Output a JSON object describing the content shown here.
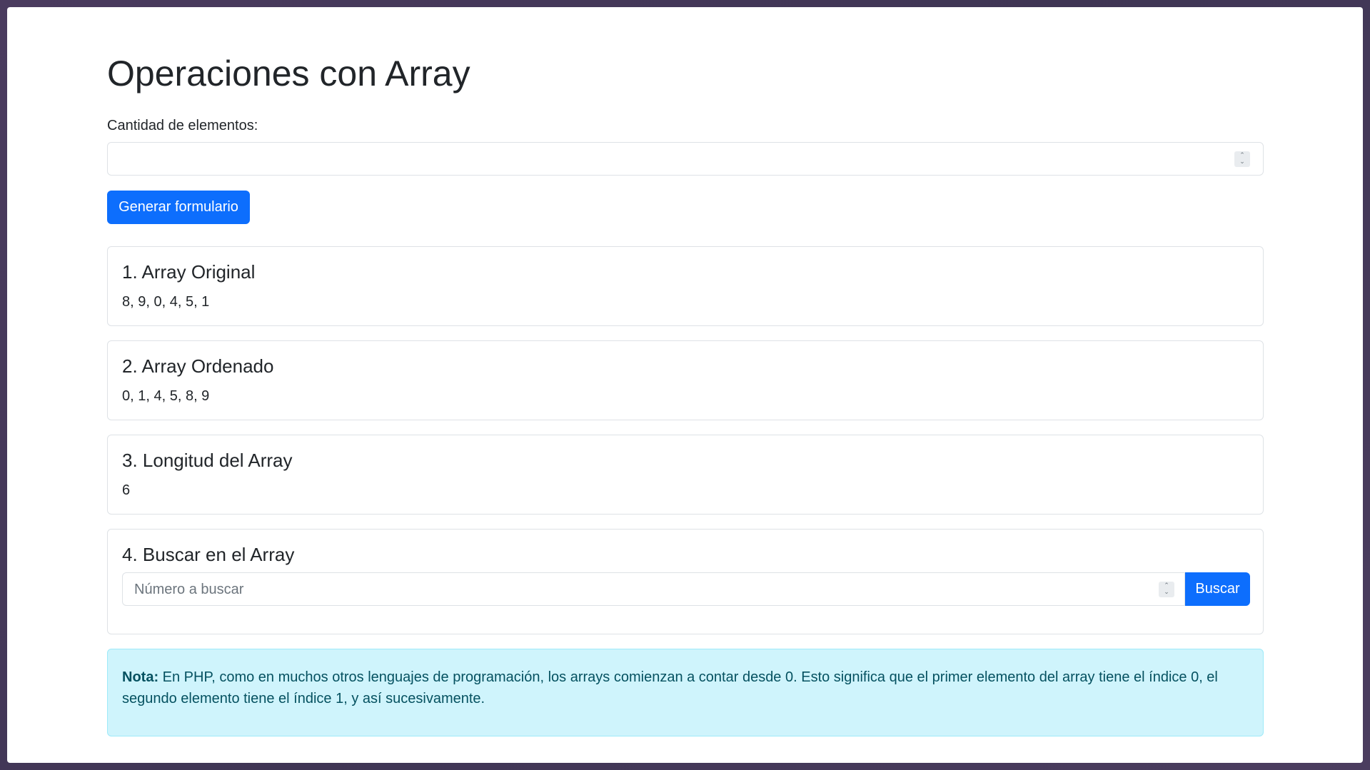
{
  "page": {
    "title": "Operaciones con Array"
  },
  "form": {
    "quantity_label": "Cantidad de elementos:",
    "quantity_value": "",
    "generate_button": "Generar formulario"
  },
  "cards": [
    {
      "title": "1. Array Original",
      "text": "8, 9, 0, 4, 5, 1"
    },
    {
      "title": "2. Array Ordenado",
      "text": "0, 1, 4, 5, 8, 9"
    },
    {
      "title": "3. Longitud del Array",
      "text": "6"
    },
    {
      "title": "4. Buscar en el Array"
    }
  ],
  "search": {
    "placeholder": "Número a buscar",
    "button": "Buscar"
  },
  "note": {
    "label": "Nota:",
    "text": " En PHP, como en muchos otros lenguajes de programación, los arrays comienzan a contar desde 0. Esto significa que el primer elemento del array tiene el índice 0, el segundo elemento tiene el índice 1, y así sucesivamente."
  },
  "colors": {
    "primary": "#0d6efd",
    "alert_bg": "#cff4fc",
    "alert_text": "#055160"
  },
  "icons": {
    "spinner": "up-down-chevron-icon"
  }
}
